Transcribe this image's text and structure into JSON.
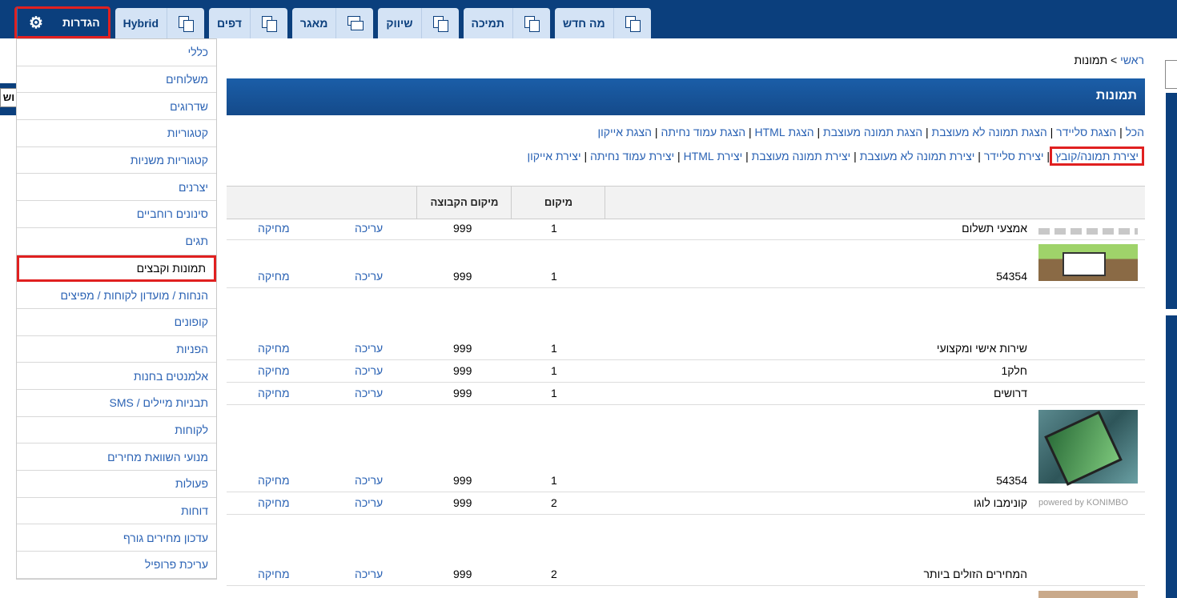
{
  "tabs": [
    {
      "label": "הגדרות",
      "icon": "gear-icon",
      "active": true
    },
    {
      "label": "Hybrid",
      "icon": "pages-icon"
    },
    {
      "label": "דפים",
      "icon": "pages-icon"
    },
    {
      "label": "מאגר",
      "icon": "windows-icon"
    },
    {
      "label": "שיווק",
      "icon": "pages-icon"
    },
    {
      "label": "תמיכה",
      "icon": "pages-icon"
    },
    {
      "label": "מה חדש",
      "icon": "pages-icon"
    }
  ],
  "left_stub_text": "וש",
  "menu": [
    "כללי",
    "משלוחים",
    "שדרוגים",
    "קטגוריות",
    "קטגוריות משניות",
    "יצרנים",
    "סינונים רוחביים",
    "תגים",
    "תמונות וקבצים",
    "הנחות / מועדון לקוחות / מפיצים",
    "קופונים",
    "הפניות",
    "אלמנטים בחנות",
    "תבניות מיילים / SMS",
    "לקוחות",
    "מנועי השוואת מחירים",
    "פעולות",
    "דוחות",
    "עדכון מחירים גורף",
    "עריכת פרופיל"
  ],
  "menu_active": "תמונות וקבצים",
  "breadcrumb": {
    "home": "ראשי",
    "sep": " > ",
    "current": "תמונות"
  },
  "section_title": "תמונות",
  "filter_links": [
    "הכל",
    "הצגת סליידר",
    "הצגת תמונה לא מעוצבת",
    "הצגת תמונה מעוצבת",
    "הצגת HTML",
    "הצגת עמוד נחיתה",
    "הצגת אייקון"
  ],
  "create_links": [
    "יצירת תמונה/קובץ",
    "יצירת סליידר",
    "יצירת תמונה לא מעוצבת",
    "יצירת תמונה מעוצבת",
    "יצירת HTML",
    "יצירת עמוד נחיתה",
    "יצירת אייקון"
  ],
  "table": {
    "headers": {
      "position": "מיקום",
      "group_position": "מיקום הקבוצה"
    },
    "rows": [
      {
        "name": "אמצעי תשלום",
        "pos": "1",
        "grp": "999",
        "edit": "עריכה",
        "del": "מחיקה",
        "thumb": "payment-logos"
      },
      {
        "name": "54354",
        "pos": "1",
        "grp": "999",
        "edit": "עריכה",
        "del": "מחיקה",
        "thumb": "devices-banner"
      },
      {
        "name": "שירות אישי ומקצועי",
        "pos": "1",
        "grp": "999",
        "edit": "עריכה",
        "del": "מחיקה",
        "thumb": ""
      },
      {
        "name": "חלק1",
        "pos": "1",
        "grp": "999",
        "edit": "עריכה",
        "del": "מחיקה",
        "thumb": ""
      },
      {
        "name": "דרושים",
        "pos": "1",
        "grp": "999",
        "edit": "עריכה",
        "del": "מחיקה",
        "thumb": ""
      },
      {
        "name": "54354",
        "pos": "1",
        "grp": "999",
        "edit": "עריכה",
        "del": "מחיקה",
        "thumb": "phone-photo"
      },
      {
        "name": "קונימבו לוגו",
        "pos": "2",
        "grp": "999",
        "edit": "עריכה",
        "del": "מחיקה",
        "thumb": "konimbo-logo"
      },
      {
        "name": "המחירים הזולים ביותר",
        "pos": "2",
        "grp": "999",
        "edit": "עריכה",
        "del": "מחיקה",
        "thumb": ""
      }
    ]
  },
  "konimbo_text": "powered by KONIMBO",
  "colors": {
    "topbar": "#0b3f7d",
    "tab": "#d4e3f5",
    "link": "#2a62b4",
    "highlight": "#e02020"
  }
}
